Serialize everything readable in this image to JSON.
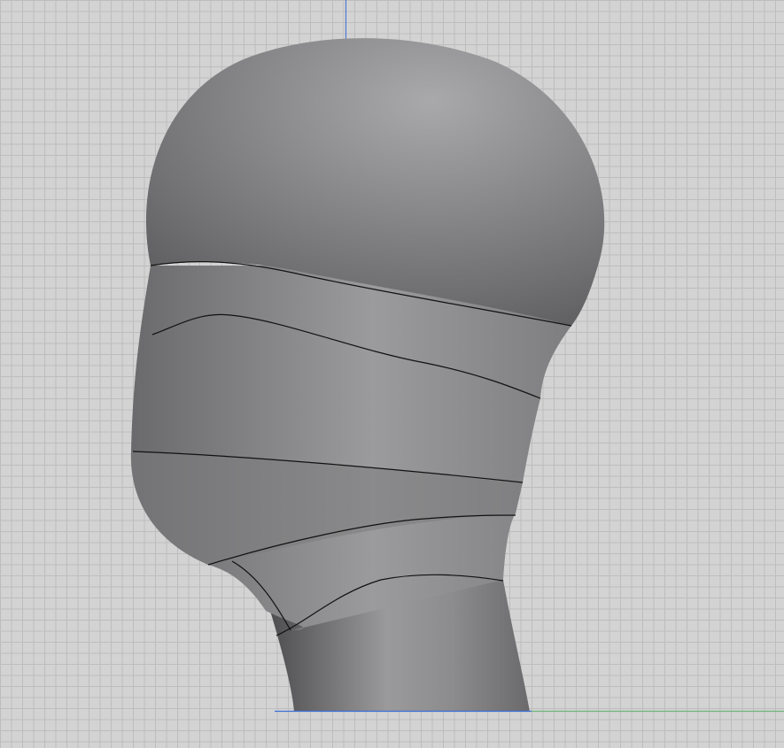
{
  "viewport": {
    "grid_color": "#bdbdbd",
    "background_color": "#d3d3d3",
    "axis_colors": {
      "vertical_axis": "#3b6fd8",
      "horizontal_axis_blue": "#3b6fd8",
      "horizontal_axis_green": "#6fb47a"
    }
  },
  "model": {
    "shape": "head-and-neck-surface",
    "shading_color": "#8a8a8c",
    "edge_line_color": "#111111"
  }
}
